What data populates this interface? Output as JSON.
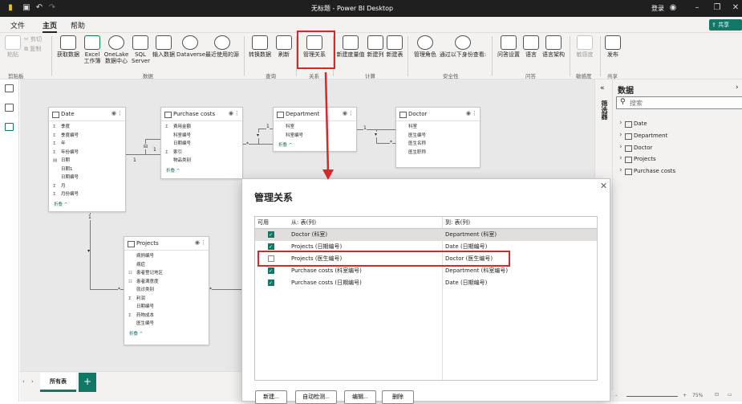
{
  "app": {
    "title": "无标题 - Power BI Desktop",
    "signin": "登录",
    "share": "共享"
  },
  "menu": {
    "items": [
      "文件",
      "主页",
      "帮助"
    ]
  },
  "ribbon": {
    "clipboard": {
      "paste": "粘贴",
      "cut": "剪切",
      "copy": "复制",
      "group": "剪贴板"
    },
    "data": {
      "get_data": "获取数据",
      "excel": "Excel 工作簿",
      "onelake": "OneLake 数据中心",
      "sql": "SQL Server",
      "enter_data": "输入数据",
      "dataverse": "Dataverse",
      "recent": "最近使用的源",
      "group": "数据"
    },
    "query": {
      "transform": "转换数据",
      "refresh": "刷新",
      "group": "查询"
    },
    "relationships": {
      "manage": "管理关系",
      "group": "关系"
    },
    "calc": {
      "new_measure": "新建度量值",
      "new_column": "新建列",
      "new_table": "新建表",
      "group": "计算"
    },
    "security": {
      "manage_roles": "管理角色",
      "view_as": "通过以下身份查看:",
      "group": "安全性"
    },
    "qa": {
      "ask": "问答设置",
      "language": "语言",
      "schema": "语言架构",
      "group": "问答"
    },
    "sensitivity": {
      "label": "敏感度",
      "group": "敏感度"
    },
    "share": {
      "publish": "发布",
      "group": "共享"
    }
  },
  "model": {
    "tables": [
      {
        "name": "Date",
        "fields": [
          {
            "s": "Σ",
            "n": "季度"
          },
          {
            "s": "Σ",
            "n": "季度编号"
          },
          {
            "s": "Σ",
            "n": "年"
          },
          {
            "s": "Σ",
            "n": "年份编号"
          },
          {
            "s": "",
            "n": "日期"
          },
          {
            "s": "",
            "n": "日期1"
          },
          {
            "s": "",
            "n": "日期编号"
          },
          {
            "s": "Σ",
            "n": "月"
          },
          {
            "s": "Σ",
            "n": "月份编号"
          }
        ]
      },
      {
        "name": "Purchase costs",
        "fields": [
          {
            "s": "Σ",
            "n": "费用金额"
          },
          {
            "s": "",
            "n": "科室编号"
          },
          {
            "s": "",
            "n": "日期编号"
          },
          {
            "s": "Σ",
            "n": "索引"
          },
          {
            "s": "",
            "n": "物品类别"
          }
        ]
      },
      {
        "name": "Department",
        "fields": [
          {
            "s": "",
            "n": "科室"
          },
          {
            "s": "",
            "n": "科室编号"
          }
        ]
      },
      {
        "name": "Doctor",
        "fields": [
          {
            "s": "",
            "n": "科室"
          },
          {
            "s": "",
            "n": "医生编号"
          },
          {
            "s": "",
            "n": "医生名称"
          },
          {
            "s": "",
            "n": "医生职称"
          }
        ]
      },
      {
        "name": "Projects",
        "fields": [
          {
            "s": "",
            "n": "病例编号"
          },
          {
            "s": "",
            "n": "病症"
          },
          {
            "s": "",
            "n": "患者登记地区"
          },
          {
            "s": "",
            "n": "患者满意度"
          },
          {
            "s": "",
            "n": "就诊类别"
          },
          {
            "s": "Σ",
            "n": "利润"
          },
          {
            "s": "",
            "n": "日期编号"
          },
          {
            "s": "Σ",
            "n": "药物成本"
          },
          {
            "s": "",
            "n": "医生编号"
          }
        ]
      }
    ],
    "collapse": "折叠 ^",
    "card_one": "1",
    "card_many": "*"
  },
  "bottom": {
    "tab": "所有表",
    "add": "+"
  },
  "dialog": {
    "title": "管理关系",
    "headers": {
      "active": "可用",
      "from": "从: 表(列)",
      "to": "到: 表(列)"
    },
    "rows": [
      {
        "active": true,
        "from": "Doctor (科室)",
        "to": "Department (科室)"
      },
      {
        "active": true,
        "from": "Projects (日期编号)",
        "to": "Date (日期编号)"
      },
      {
        "active": false,
        "from": "Projects (医生编号)",
        "to": "Doctor (医生编号)"
      },
      {
        "active": true,
        "from": "Purchase costs (科室编号)",
        "to": "Department (科室编号)"
      },
      {
        "active": true,
        "from": "Purchase costs (日期编号)",
        "to": "Date (日期编号)"
      }
    ],
    "buttons": {
      "new": "新建...",
      "autodetect": "自动检测...",
      "edit": "编辑...",
      "delete": "删除"
    }
  },
  "data_pane": {
    "title": "数据",
    "search_placeholder": "搜索",
    "side_label": "筛选器",
    "tables": [
      "Date",
      "Department",
      "Doctor",
      "Projects",
      "Purchase costs"
    ]
  },
  "status": {
    "zoom": "75%"
  },
  "colors": {
    "accent": "#117865",
    "highlight": "#d62828"
  }
}
